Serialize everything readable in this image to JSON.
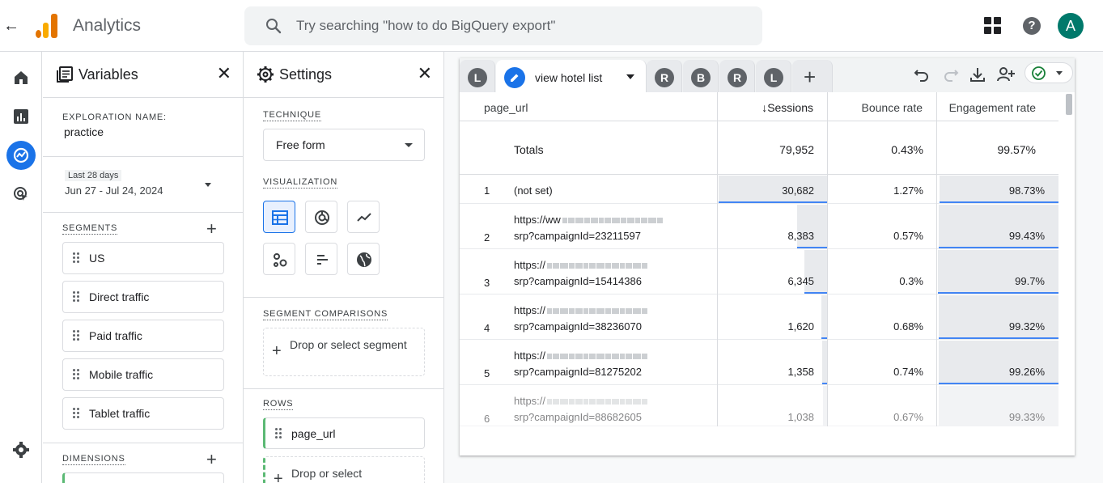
{
  "app": {
    "title": "Analytics",
    "search_placeholder": "Try searching \"how to do BigQuery export\"",
    "avatar_letter": "A",
    "accent_color": "#1a73e8",
    "avatar_color": "#00796b"
  },
  "variables": {
    "title": "Variables",
    "exploration_label": "EXPLORATION NAME:",
    "exploration_name": "practice",
    "date_label": "Last 28 days",
    "date_range": "Jun 27 - Jul 24, 2024",
    "segments_label": "SEGMENTS",
    "segments": [
      "US",
      "Direct traffic",
      "Paid traffic",
      "Mobile traffic",
      "Tablet traffic"
    ],
    "dimensions_label": "DIMENSIONS"
  },
  "settings": {
    "title": "Settings",
    "technique_label": "TECHNIQUE",
    "technique_value": "Free form",
    "visualization_label": "VISUALIZATION",
    "segment_comparisons_label": "SEGMENT COMPARISONS",
    "drop_segment": "Drop or select segment",
    "rows_label": "ROWS",
    "row_dimension": "page_url",
    "drop_dimension": "Drop or select"
  },
  "tabs": {
    "letters": [
      "L",
      "R",
      "B",
      "R",
      "L"
    ],
    "active_name": "view hotel list"
  },
  "table": {
    "headers": {
      "dimension": "page_url",
      "sessions": "Sessions",
      "bounce": "Bounce rate",
      "engagement": "Engagement rate"
    },
    "totals": {
      "label": "Totals",
      "sessions": "79,952",
      "bounce": "0.43%",
      "engagement": "99.57%"
    },
    "rows": [
      {
        "num": "1",
        "url1": "(not set)",
        "url2": "",
        "sessions": "30,682",
        "bounce": "1.27%",
        "engagement": "98.73%",
        "sessions_value": 30682,
        "bounce_value": 1.27,
        "engagement_value": 98.73
      },
      {
        "num": "2",
        "url1": "https://ww",
        "url2": "srp?campaignId=23211597",
        "sessions": "8,383",
        "bounce": "0.57%",
        "engagement": "99.43%",
        "sessions_value": 8383,
        "bounce_value": 0.57,
        "engagement_value": 99.43
      },
      {
        "num": "3",
        "url1": "https://",
        "url2": "srp?campaignId=15414386",
        "sessions": "6,345",
        "bounce": "0.3%",
        "engagement": "99.7%",
        "sessions_value": 6345,
        "bounce_value": 0.3,
        "engagement_value": 99.7
      },
      {
        "num": "4",
        "url1": "https://",
        "url2": "srp?campaignId=38236070",
        "sessions": "1,620",
        "bounce": "0.68%",
        "engagement": "99.32%",
        "sessions_value": 1620,
        "bounce_value": 0.68,
        "engagement_value": 99.32
      },
      {
        "num": "5",
        "url1": "https://",
        "url2": "srp?campaignId=81275202",
        "sessions": "1,358",
        "bounce": "0.74%",
        "engagement": "99.26%",
        "sessions_value": 1358,
        "bounce_value": 0.74,
        "engagement_value": 99.26
      },
      {
        "num": "6",
        "url1": "https://",
        "url2": "srp?campaignId=88682605",
        "sessions": "1,038",
        "bounce": "0.67%",
        "engagement": "99.33%",
        "sessions_value": 1038,
        "bounce_value": 0.67,
        "engagement_value": 99.33
      }
    ]
  }
}
